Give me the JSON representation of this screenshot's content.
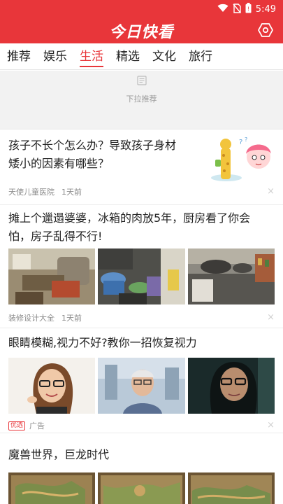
{
  "status_bar": {
    "time": "5:49",
    "icons": [
      "wifi-icon",
      "no-sim-icon",
      "battery-icon"
    ]
  },
  "app": {
    "title": "今日快看",
    "accent": "#e8363a"
  },
  "tabs": [
    {
      "label": "推荐",
      "active": false
    },
    {
      "label": "娱乐",
      "active": false
    },
    {
      "label": "生活",
      "active": true
    },
    {
      "label": "精选",
      "active": false
    },
    {
      "label": "文化",
      "active": false
    },
    {
      "label": "旅行",
      "active": false
    }
  ],
  "pull": {
    "text": "下拉推荐"
  },
  "feed": [
    {
      "title_line1": "孩子不长个怎么办？导致孩子身材",
      "title_line2": "矮小的因素有哪些？",
      "source": "天使儿童医院",
      "time": "1天前",
      "ad_label": ""
    },
    {
      "title_line1": "摊上个邋遢婆婆，冰箱的肉放5年，厨房看了你会",
      "title_line2": "怕，房子乱得不行!",
      "source": "装修设计大全",
      "time": "1天前",
      "ad_label": ""
    },
    {
      "title_line1": "眼睛模糊,视力不好?教你一招恢复视力",
      "title_line2": "",
      "source": "广告",
      "time": "",
      "ad_label": "优选"
    },
    {
      "title_line1": "魔兽世界，巨龙时代",
      "title_line2": "",
      "source": "",
      "time": "",
      "ad_label": ""
    }
  ],
  "close_glyph": "×"
}
